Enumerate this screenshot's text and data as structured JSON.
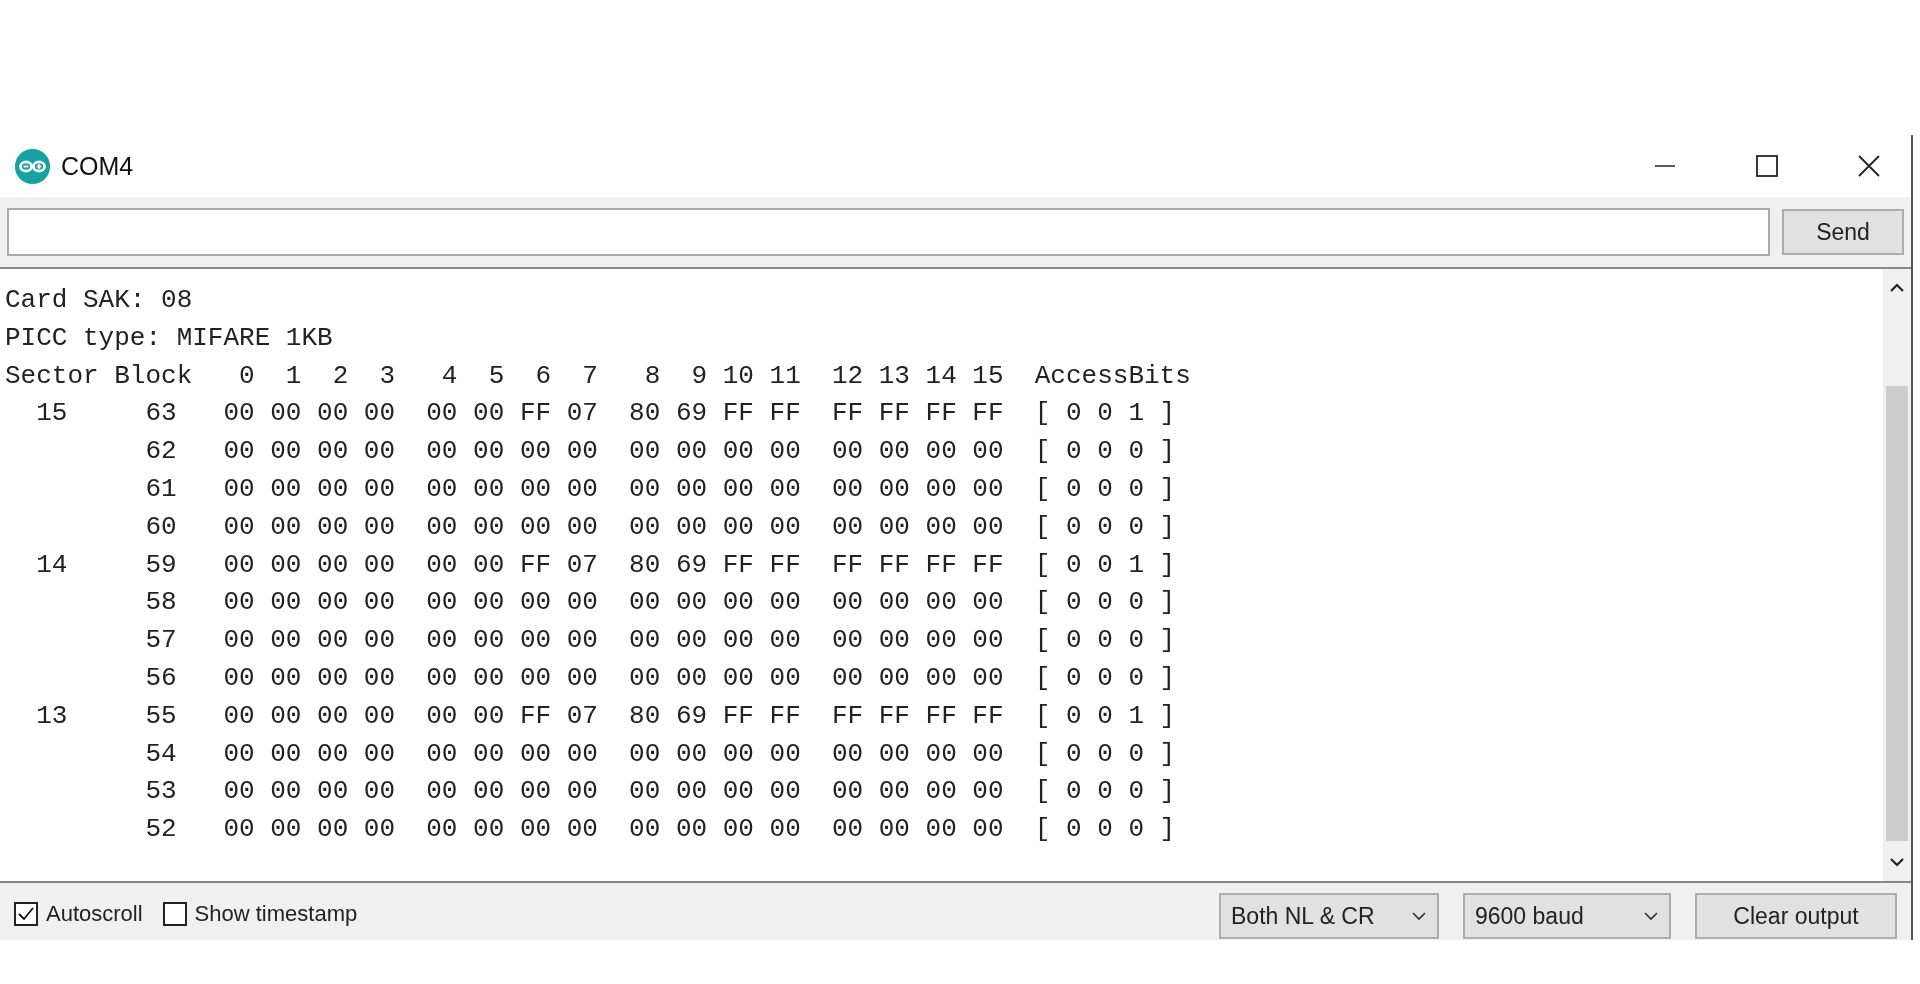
{
  "window": {
    "title": "COM4"
  },
  "send_button": "Send",
  "output_lines": [
    "Card SAK: 08",
    "PICC type: MIFARE 1KB",
    "Sector Block   0  1  2  3   4  5  6  7   8  9 10 11  12 13 14 15  AccessBits",
    "  15     63   00 00 00 00  00 00 FF 07  80 69 FF FF  FF FF FF FF  [ 0 0 1 ]",
    "         62   00 00 00 00  00 00 00 00  00 00 00 00  00 00 00 00  [ 0 0 0 ]",
    "         61   00 00 00 00  00 00 00 00  00 00 00 00  00 00 00 00  [ 0 0 0 ]",
    "         60   00 00 00 00  00 00 00 00  00 00 00 00  00 00 00 00  [ 0 0 0 ]",
    "  14     59   00 00 00 00  00 00 FF 07  80 69 FF FF  FF FF FF FF  [ 0 0 1 ]",
    "         58   00 00 00 00  00 00 00 00  00 00 00 00  00 00 00 00  [ 0 0 0 ]",
    "         57   00 00 00 00  00 00 00 00  00 00 00 00  00 00 00 00  [ 0 0 0 ]",
    "         56   00 00 00 00  00 00 00 00  00 00 00 00  00 00 00 00  [ 0 0 0 ]",
    "  13     55   00 00 00 00  00 00 FF 07  80 69 FF FF  FF FF FF FF  [ 0 0 1 ]",
    "         54   00 00 00 00  00 00 00 00  00 00 00 00  00 00 00 00  [ 0 0 0 ]",
    "         53   00 00 00 00  00 00 00 00  00 00 00 00  00 00 00 00  [ 0 0 0 ]",
    "         52   00 00 00 00  00 00 00 00  00 00 00 00  00 00 00 00  [ 0 0 0 ]"
  ],
  "options": [
    {
      "label": "Autoscroll",
      "checked": true
    },
    {
      "label": "Show timestamp",
      "checked": false
    }
  ],
  "dropdowns": [
    {
      "value": "Both NL & CR"
    },
    {
      "value": "9600 baud"
    }
  ],
  "clear_button": "Clear output"
}
